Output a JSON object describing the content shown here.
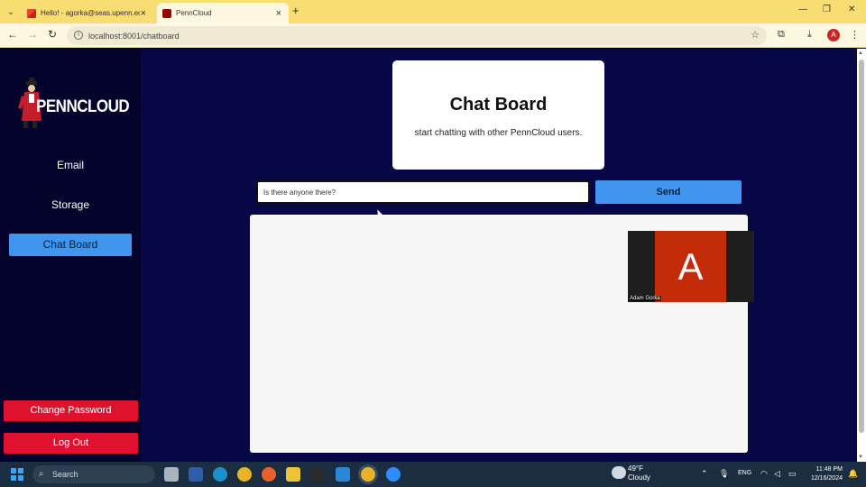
{
  "browser": {
    "tabs": [
      {
        "title": "Hello! - agorka@seas.upenn.edu",
        "active": false
      },
      {
        "title": "PennCloud",
        "active": true
      }
    ],
    "url": "localhost:8001/chatboard"
  },
  "sidebar": {
    "logo_text": "PENNCLOUD",
    "nav": [
      {
        "label": "Email",
        "active": false
      },
      {
        "label": "Storage",
        "active": false
      },
      {
        "label": "Chat Board",
        "active": true
      }
    ],
    "change_password_label": "Change Password",
    "logout_label": "Log Out"
  },
  "header": {
    "title": "Chat Board",
    "subtitle": "start chatting with other PennCloud users."
  },
  "composer": {
    "value": "Is there anyone there?",
    "send_label": "Send"
  },
  "video": {
    "initial": "A",
    "name": "Adam Gorka"
  },
  "taskbar": {
    "search_label": "Search",
    "weather_temp": "49°F",
    "weather_desc": "Cloudy",
    "lang": "ENG",
    "time": "11:48 PM",
    "date": "12/16/2024"
  },
  "colors": {
    "accent_blue": "#4095ee",
    "danger_red": "#e0102f",
    "page_bg": "#070745",
    "sidebar_bg": "#03032b"
  }
}
